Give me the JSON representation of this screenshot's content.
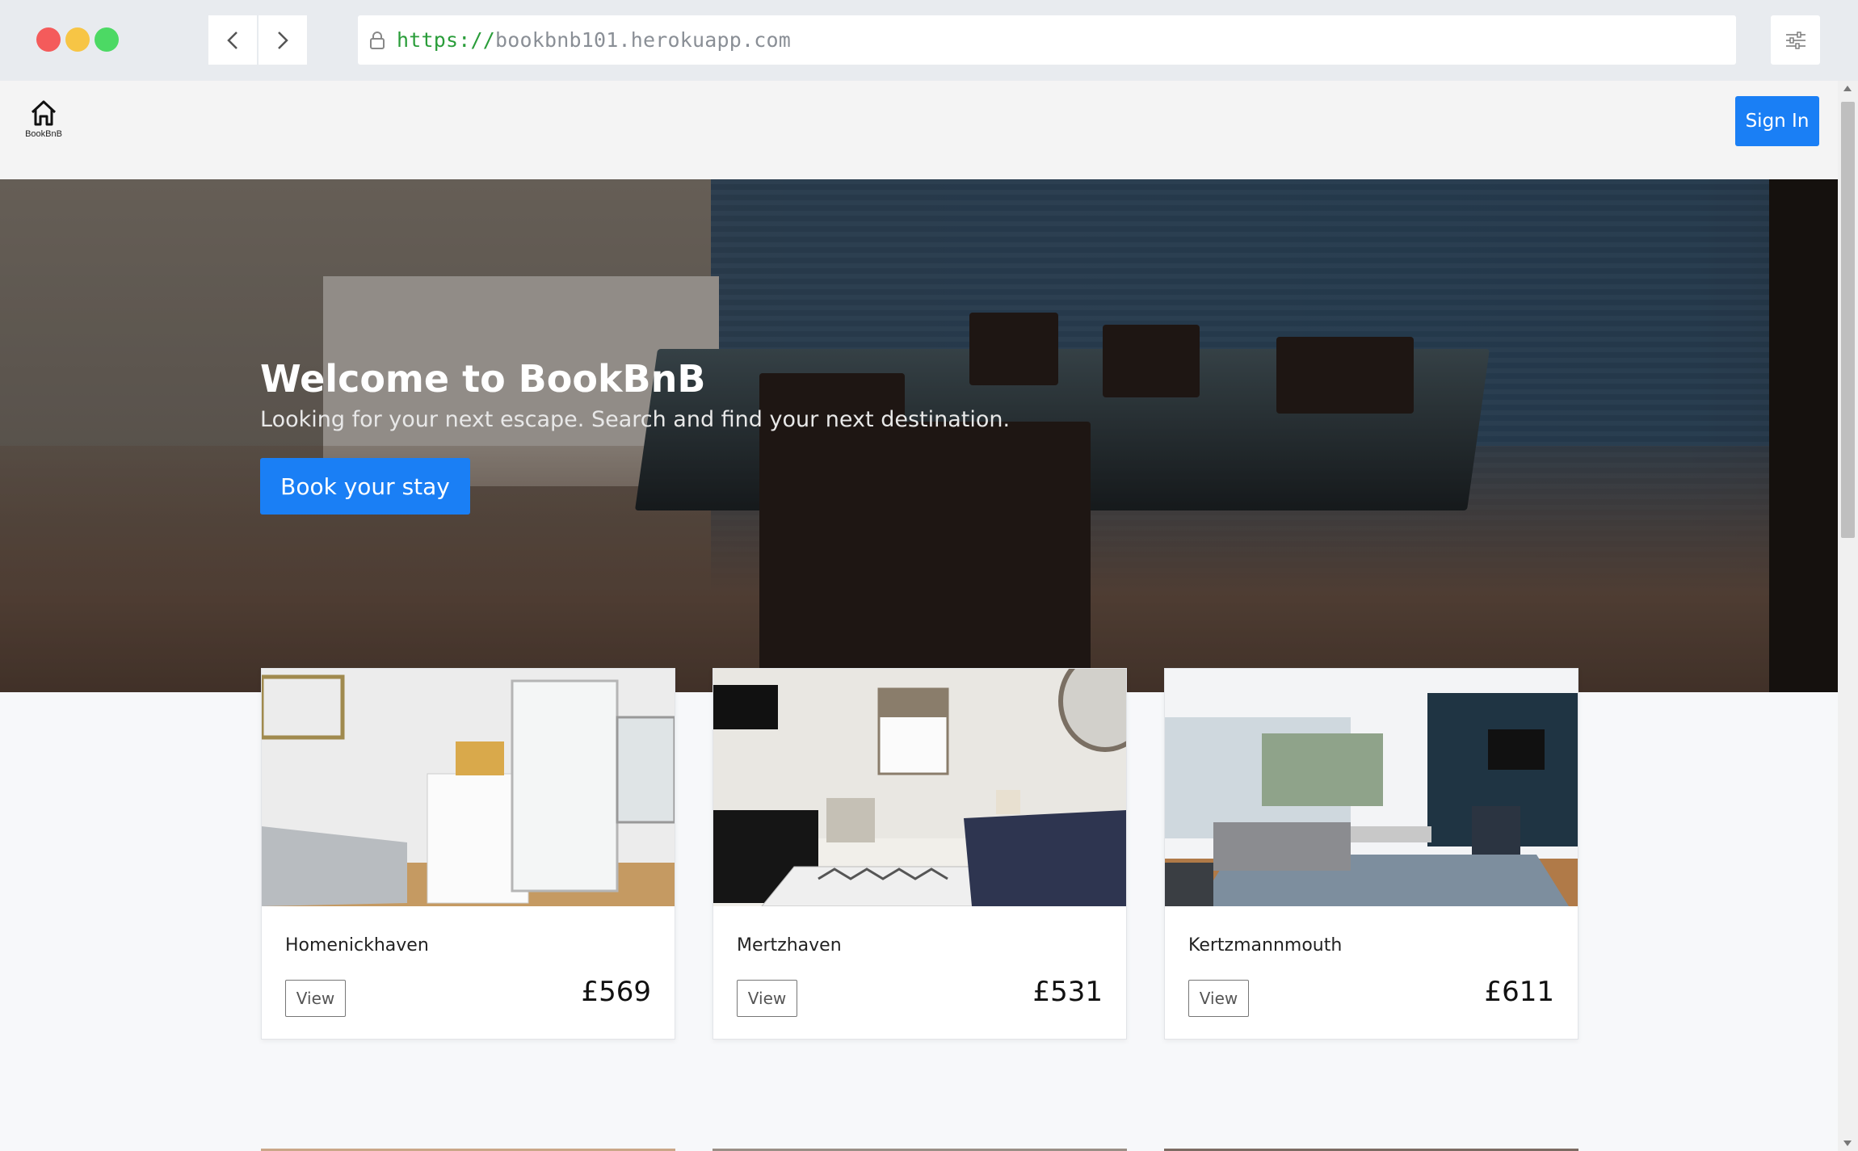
{
  "browser": {
    "url_scheme": "https://",
    "url_host": "bookbnb101.herokuapp.com"
  },
  "header": {
    "logo_text": "BookBnB",
    "signin_label": "Sign In"
  },
  "hero": {
    "title": "Welcome to BookBnB",
    "subtitle": "Looking for your next escape. Search and find your next destination.",
    "cta_label": "Book your stay"
  },
  "listings": [
    {
      "name": "Homenickhaven",
      "view_label": "View",
      "price": "£569"
    },
    {
      "name": "Mertzhaven",
      "view_label": "View",
      "price": "£531"
    },
    {
      "name": "Kertzmannmouth",
      "view_label": "View",
      "price": "£611"
    }
  ],
  "colors": {
    "accent": "#1a7ff5",
    "url_scheme": "#2a9d3a"
  }
}
